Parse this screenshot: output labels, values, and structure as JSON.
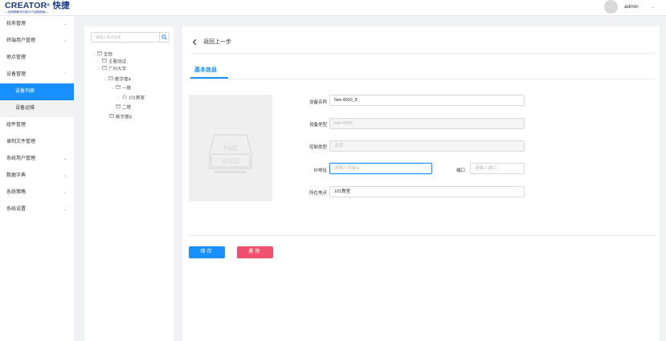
{
  "header": {
    "logo_main": "CREATOR",
    "logo_cn": "快捷",
    "logo_sub": "—全视频解决方案与产品制造商—",
    "username": "admin"
  },
  "sidebar": {
    "items": [
      {
        "label": "校务管理",
        "chevron": true
      },
      {
        "label": "终端用户管理",
        "chevron": true
      },
      {
        "label": "地点管理",
        "chevron": false
      },
      {
        "label": "设备管理",
        "chevron": true,
        "expanded": true
      },
      {
        "label": "组件管理",
        "chevron": false
      },
      {
        "label": "录制文件管理",
        "chevron": false
      },
      {
        "label": "系统用户管理",
        "chevron": true
      },
      {
        "label": "数据字典",
        "chevron": true
      },
      {
        "label": "系统策略",
        "chevron": true
      },
      {
        "label": "系统设置",
        "chevron": true
      }
    ],
    "subitems": [
      {
        "label": "设备列表",
        "active": true
      },
      {
        "label": "设备运维",
        "active": false
      }
    ]
  },
  "tree": {
    "search_placeholder": "请输入地点名称",
    "nodes": [
      {
        "label": "全部",
        "type": "folder",
        "expanded": true
      },
      {
        "label": "主要测试",
        "type": "folder",
        "expanded": false
      },
      {
        "label": "广州大学",
        "type": "folder",
        "expanded": true
      },
      {
        "label": "教学楼A",
        "type": "folder",
        "expanded": true
      },
      {
        "label": "一楼",
        "type": "folder",
        "expanded": true
      },
      {
        "label": "101教室",
        "type": "home",
        "expanded": false
      },
      {
        "label": "二楼",
        "type": "folder",
        "expanded": false
      },
      {
        "label": "教学楼B",
        "type": "folder",
        "expanded": false
      }
    ]
  },
  "main": {
    "back_label": "返回上一步",
    "tab_label": "基本信息",
    "device_image": {
      "line1": "Net",
      "line2": "4000"
    },
    "form": {
      "name_label": "设备名称",
      "name_value": "Net-4000_8",
      "type_label": "设备类型",
      "type_value": "Net-4000",
      "control_label": "控制类型",
      "control_value": "主控",
      "ip_label": "IP地址",
      "ip_placeholder": "请输入设备ip",
      "port_label": "端口",
      "port_placeholder": "请输入端口",
      "location_label": "所在地点",
      "location_value": "101教室"
    },
    "save_label": "保存",
    "delete_label": "删除"
  },
  "colors": {
    "accent": "#1890ff",
    "danger": "#f0506e",
    "brand": "#1a3a8a"
  }
}
